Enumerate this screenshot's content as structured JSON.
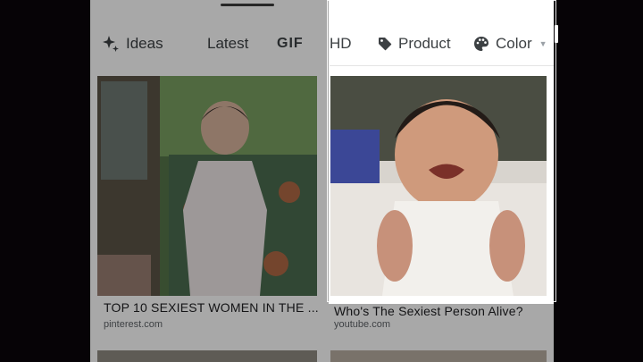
{
  "filters": {
    "ideas": "Ideas",
    "latest": "Latest",
    "gif": "GIF",
    "hd": "HD",
    "product": "Product",
    "color": "Color"
  },
  "results": [
    {
      "caption": "TOP 10 SEXIEST WOMEN IN THE ...",
      "source": "pinterest.com"
    },
    {
      "caption": "Who's The Sexiest Person Alive?",
      "source": "youtube.com"
    }
  ],
  "icons": {
    "ideas": "sparkle-icon",
    "product": "tag-icon",
    "color": "palette-icon",
    "color_caret": "caret-down-icon"
  },
  "colors": {
    "background": "#060306",
    "surface": "#ffffff",
    "text": "#202124",
    "muted": "#5f6368"
  }
}
